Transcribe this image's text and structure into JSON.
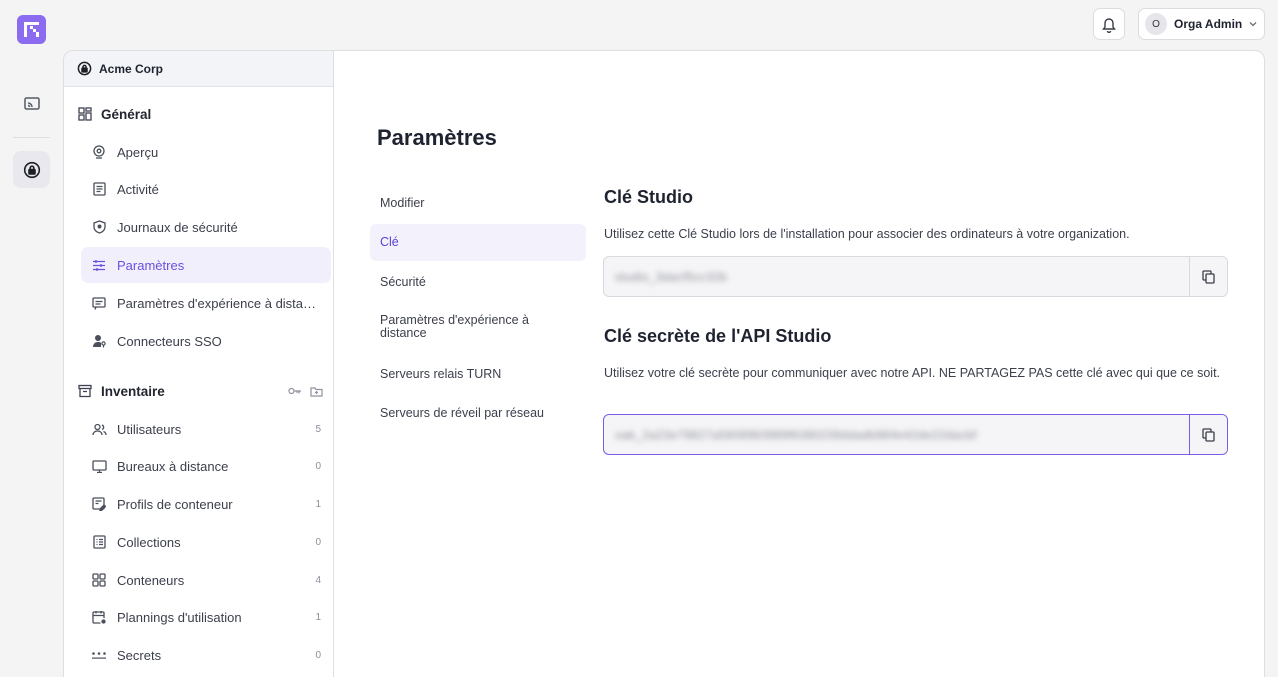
{
  "header": {
    "user_initial": "O",
    "user_name": "Orga Admin"
  },
  "org": {
    "name": "Acme Corp"
  },
  "sidebar": {
    "general_label": "Général",
    "general_items": [
      {
        "label": "Aperçu",
        "icon": "webcam-icon"
      },
      {
        "label": "Activité",
        "icon": "document-icon"
      },
      {
        "label": "Journaux de sécurité",
        "icon": "shield-icon"
      },
      {
        "label": "Paramètres",
        "icon": "sliders-icon",
        "active": true
      },
      {
        "label": "Paramètres d'expérience à distance",
        "icon": "message-square-icon"
      },
      {
        "label": "Connecteurs SSO",
        "icon": "user-key-icon"
      }
    ],
    "inventory_label": "Inventaire",
    "inventory_items": [
      {
        "label": "Utilisateurs",
        "count": "5",
        "icon": "users-icon"
      },
      {
        "label": "Bureaux à distance",
        "count": "0",
        "icon": "monitor-icon"
      },
      {
        "label": "Profils de conteneur",
        "count": "1",
        "icon": "profile-edit-icon"
      },
      {
        "label": "Collections",
        "count": "0",
        "icon": "list-icon"
      },
      {
        "label": "Conteneurs",
        "count": "4",
        "icon": "grid-icon"
      },
      {
        "label": "Plannings d'utilisation",
        "count": "1",
        "icon": "calendar-clock-icon"
      },
      {
        "label": "Secrets",
        "count": "0",
        "icon": "dots-icon"
      }
    ]
  },
  "main": {
    "title": "Paramètres",
    "subnav": [
      {
        "label": "Modifier"
      },
      {
        "label": "Clé",
        "active": true
      },
      {
        "label": "Sécurité"
      },
      {
        "label": "Paramètres d'expérience à distance"
      },
      {
        "label": "Serveurs relais TURN"
      },
      {
        "label": "Serveurs de réveil par réseau"
      }
    ],
    "studio_key": {
      "title": "Clé Studio",
      "description": "Utilisez cette Clé Studio lors de l'installation pour associer des ordinateurs à votre organization.",
      "value": "studio_3dacf5cc32b"
    },
    "api_key": {
      "title": "Clé secrète de l'API Studio",
      "description": "Utilisez votre clé secrète pour communiquer avec notre API. NE PARTAGEZ PAS cette clé avec qui que ce soit.",
      "value": "oak_2a23e79827a5808983989f6380239ddadb984e42de22dacbf"
    }
  },
  "colors": {
    "accent": "#7c5ce6",
    "logo": "#8b6cf0"
  }
}
